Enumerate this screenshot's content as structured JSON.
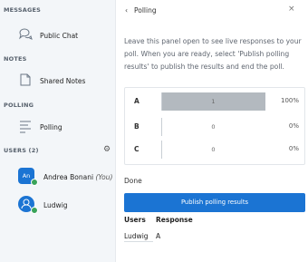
{
  "sidebar": {
    "messages_title": "MESSAGES",
    "public_chat": "Public Chat",
    "notes_title": "NOTES",
    "shared_notes": "Shared Notes",
    "polling_title": "POLLING",
    "polling": "Polling",
    "users_title": "USERS (2)",
    "users": [
      {
        "initials": "An",
        "name": "Andrea Bonani",
        "suffix": "(You)",
        "color": "#1b74d3"
      },
      {
        "initials": "",
        "name": "Ludwig",
        "suffix": "",
        "color": "#1b74d3"
      }
    ]
  },
  "panel": {
    "back_glyph": "‹",
    "title": "Polling",
    "close_glyph": "×",
    "description": "Leave this panel open to see live responses to your poll. When you are ready, select 'Publish polling results' to publish the results and end the poll.",
    "results": [
      {
        "label": "A",
        "count": "1",
        "percent": "100%",
        "fraction": 1.0
      },
      {
        "label": "B",
        "count": "0",
        "percent": "0%",
        "fraction": 0
      },
      {
        "label": "C",
        "count": "0",
        "percent": "0%",
        "fraction": 0
      }
    ],
    "done_label": "Done",
    "publish_button": "Publish polling results",
    "table": {
      "headers": [
        "Users",
        "Response"
      ],
      "rows": [
        [
          "Ludwig",
          "A"
        ]
      ]
    }
  },
  "colors": {
    "accent": "#1b74d3",
    "bar": "#b3b9bf",
    "online": "#3aa35a"
  }
}
